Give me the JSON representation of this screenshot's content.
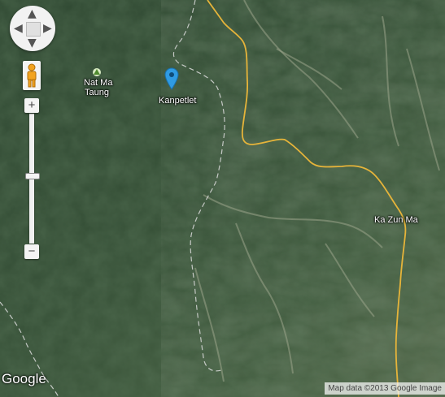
{
  "map": {
    "places": {
      "nat_ma_taung_line1": "Nat Ma",
      "nat_ma_taung_line2": "Taung",
      "kanpetlet": "Kanpetlet",
      "ka_zun_ma": "Ka Zun Ma"
    },
    "controls": {
      "pan_up": "❮",
      "zoom_in": "+",
      "zoom_out": "−"
    },
    "logo": "Google",
    "attribution": "Map data ©2013 Google Image",
    "colors": {
      "terrain_dark": "#2c4530",
      "terrain_mid": "#3f5a3e",
      "border_line": "#e8b63a",
      "dashed_road": "#d8d8d8",
      "marker": "#2f9be3"
    },
    "icons": [
      "park-icon",
      "map-pin-icon",
      "pegman-icon"
    ]
  }
}
